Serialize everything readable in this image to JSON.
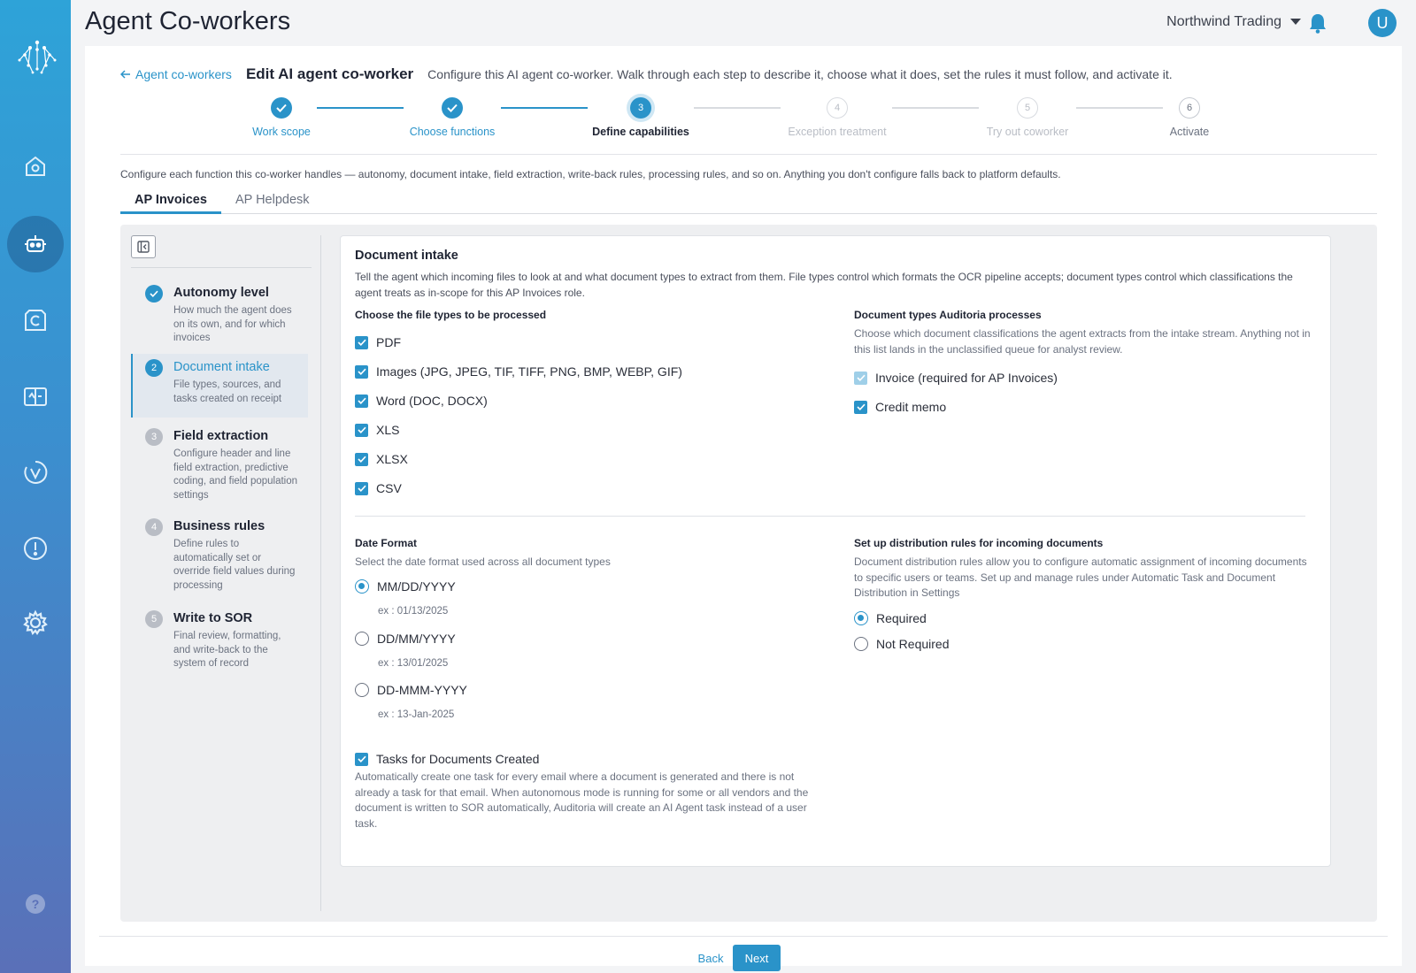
{
  "app": {
    "title": "Agent Co-workers",
    "org": "Northwind Trading",
    "avatar_initial": "U"
  },
  "rail": {
    "items": [
      "logo-icon",
      "home-icon",
      "robot-icon",
      "c-icon",
      "book-icon",
      "v-icon",
      "alert-icon",
      "gear-icon",
      "help-icon"
    ],
    "active": "robot-icon"
  },
  "header": {
    "back_link": "Agent co-workers",
    "title": "Edit AI agent co-worker",
    "description": "Configure this AI agent co-worker. Walk through each step to describe it, choose what it does, set the rules it must follow, and activate it."
  },
  "stepper": {
    "steps": [
      {
        "number": "1",
        "label": "Work scope",
        "state": "done"
      },
      {
        "number": "2",
        "label": "Choose functions",
        "state": "done"
      },
      {
        "number": "3",
        "label": "Define capabilities",
        "state": "current"
      },
      {
        "number": "4",
        "label": "Exception treatment",
        "state": "todo"
      },
      {
        "number": "5",
        "label": "Try out coworker",
        "state": "todo"
      },
      {
        "number": "6",
        "label": "Activate",
        "state": "todo"
      }
    ]
  },
  "intro": "Configure each function this co-worker handles — autonomy, document intake, field extraction, write-back rules, processing rules, and so on. Anything you don't configure falls back to platform defaults.",
  "tabs": [
    {
      "label": "AP Invoices",
      "active": true
    },
    {
      "label": "AP Helpdesk",
      "active": false
    }
  ],
  "sidebar": {
    "items": [
      {
        "number": "1",
        "title": "Autonomy level",
        "desc": "How much the agent does on its own, and for which invoices",
        "state": "done"
      },
      {
        "number": "2",
        "title": "Document intake",
        "desc": "File types, sources, and tasks created on receipt",
        "state": "current"
      },
      {
        "number": "3",
        "title": "Field extraction",
        "desc": "Configure header and line field extraction, predictive coding, and field population settings",
        "state": "todo"
      },
      {
        "number": "4",
        "title": "Business rules",
        "desc": "Define rules to automatically set or override field values during processing",
        "state": "todo"
      },
      {
        "number": "5",
        "title": "Write to SOR",
        "desc": "Final review, formatting, and write-back to the system of record",
        "state": "todo"
      }
    ]
  },
  "intake": {
    "title": "Document intake",
    "description": "Tell the agent which incoming files to look at and what document types to extract from them. File types control which formats the OCR pipeline accepts; document types control which classifications the agent treats as in-scope for this AP Invoices role.",
    "file_types": {
      "title": "Choose the file types to be processed",
      "options": [
        {
          "label": "PDF",
          "checked": true
        },
        {
          "label": "Images (JPG, JPEG, TIF, TIFF, PNG, BMP, WEBP, GIF)",
          "checked": true
        },
        {
          "label": "Word (DOC, DOCX)",
          "checked": true
        },
        {
          "label": "XLS",
          "checked": true
        },
        {
          "label": "XLSX",
          "checked": true
        },
        {
          "label": "CSV",
          "checked": true
        }
      ]
    },
    "doc_types": {
      "title": "Document types Auditoria processes",
      "description": "Choose which document classifications the agent extracts from the intake stream. Anything not in this list lands in the unclassified queue for analyst review.",
      "options": [
        {
          "label": "Invoice (required for AP Invoices)",
          "checked": true,
          "disabled": true
        },
        {
          "label": "Credit memo",
          "checked": true,
          "disabled": false
        }
      ]
    },
    "date_format": {
      "title": "Date Format",
      "description": "Select the date format used across all document types",
      "options": [
        {
          "label": "MM/DD/YYYY",
          "example": "ex : 01/13/2025",
          "selected": true
        },
        {
          "label": "DD/MM/YYYY",
          "example": "ex : 13/01/2025",
          "selected": false
        },
        {
          "label": "DD-MMM-YYYY",
          "example": "ex : 13-Jan-2025",
          "selected": false
        }
      ]
    },
    "distribution": {
      "title": "Set up distribution rules for incoming documents",
      "description": "Document distribution rules allow you to configure automatic assignment of incoming documents to specific users or teams. Set up and manage rules under Automatic Task and Document Distribution in Settings",
      "options": [
        {
          "label": "Required",
          "selected": true
        },
        {
          "label": "Not Required",
          "selected": false
        }
      ]
    },
    "tasks": {
      "label": "Tasks for Documents Created",
      "checked": true,
      "description": "Automatically create one task for every email where a document is generated and there is not already a task for that email. When autonomous mode is running for some or all vendors and the document is written to SOR automatically, Auditoria will create an AI Agent task instead of a user task."
    }
  },
  "footer": {
    "back_label": "Back",
    "next_label": "Next"
  },
  "colors": {
    "accent": "#2a93c9",
    "rail_top": "#2ea3d8",
    "rail_bottom": "#5a70b8"
  }
}
